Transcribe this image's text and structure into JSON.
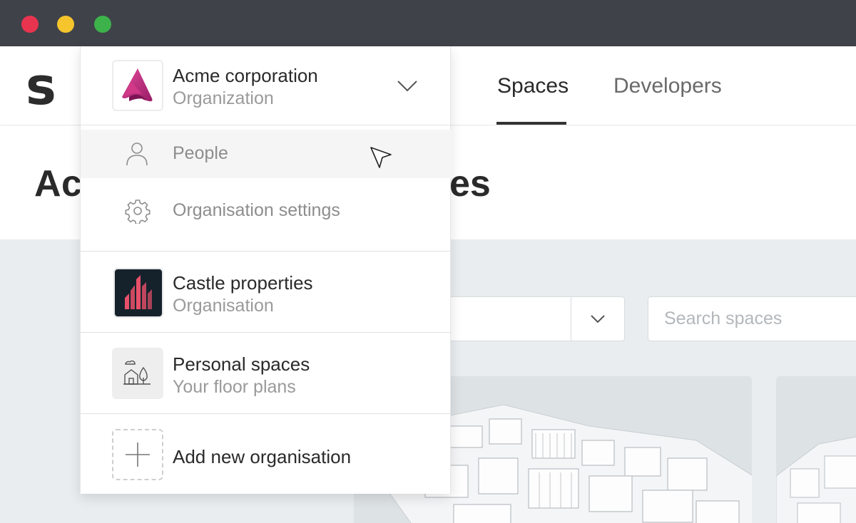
{
  "window": {
    "controls": [
      "close",
      "minimize",
      "maximize"
    ]
  },
  "header": {
    "logo": "s",
    "tabs": [
      {
        "label": "Spaces",
        "active": true
      },
      {
        "label": "Developers",
        "active": false
      }
    ]
  },
  "page": {
    "title_start": "Ac",
    "title_end": "es"
  },
  "filters": {
    "search_placeholder": "Search spaces"
  },
  "dropdown": {
    "current_org": {
      "name": "Acme corporation",
      "type": "Organization",
      "icon": "acme-logo"
    },
    "menu": [
      {
        "label": "People",
        "icon": "person-icon"
      },
      {
        "label": "Organisation settings",
        "icon": "gear-icon"
      }
    ],
    "orgs": [
      {
        "name": "Castle properties",
        "sub": "Organisation",
        "icon": "castle-logo"
      },
      {
        "name": "Personal spaces",
        "sub": "Your floor plans",
        "icon": "house-tree-icon"
      }
    ],
    "add_label": "Add new organisation"
  },
  "colors": {
    "titlebar": "#3f4249",
    "content_bg": "#e9edf0",
    "acme_brand": "#c9267f",
    "castle_bg": "#15222c",
    "castle_accent": "#e8506a"
  }
}
